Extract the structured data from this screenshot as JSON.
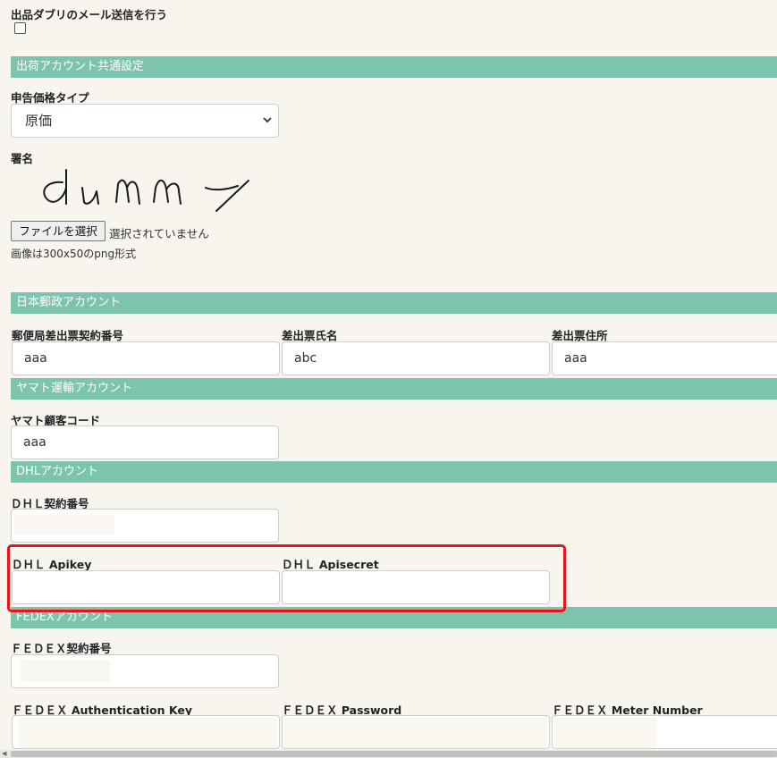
{
  "dup_mail": {
    "label": "出品ダブリのメール送信を行う",
    "checked": false
  },
  "shipping_common": {
    "section_title": "出荷アカウント共通設定",
    "declared_price_type": {
      "label": "申告価格タイプ",
      "selected": "原価"
    },
    "signature": {
      "label": "署名",
      "image_alt": "dummy",
      "file_button": "ファイルを選択",
      "file_status": "選択されていません",
      "hint": "画像は300x50のpng形式"
    }
  },
  "japan_post": {
    "section_title": "日本郵政アカウント",
    "contract_number": {
      "label": "郵便局差出票契約番号",
      "value": "aaa"
    },
    "sender_name": {
      "label": "差出票氏名",
      "value": "abc"
    },
    "sender_address": {
      "label": "差出票住所",
      "value": "aaa"
    }
  },
  "yamato": {
    "section_title": "ヤマト運輸アカウント",
    "customer_code": {
      "label": "ヤマト顧客コード",
      "value": "aaa"
    }
  },
  "dhl": {
    "section_title": "DHLアカウント",
    "contract_number": {
      "label": "ＤＨＬ契約番号",
      "value": ""
    },
    "apikey": {
      "label": "ＤＨＬ Apikey",
      "value": ""
    },
    "apisecret": {
      "label": "ＤＨＬ Apisecret",
      "value": ""
    }
  },
  "fedex": {
    "section_title": "FEDEXアカウント",
    "contract_number": {
      "label": "ＦＥＤＥＸ契約番号",
      "value": ""
    },
    "auth_key": {
      "label": "ＦＥＤＥＸ Authentication Key",
      "value": ""
    },
    "password": {
      "label": "ＦＥＤＥＸ Password",
      "value": ""
    },
    "meter_number": {
      "label": "ＦＥＤＥＸ Meter Number",
      "value": ""
    }
  },
  "colors": {
    "section_header": "#7cc4ad",
    "page_bg": "#f8f4ee",
    "highlight": "#e8131b"
  }
}
